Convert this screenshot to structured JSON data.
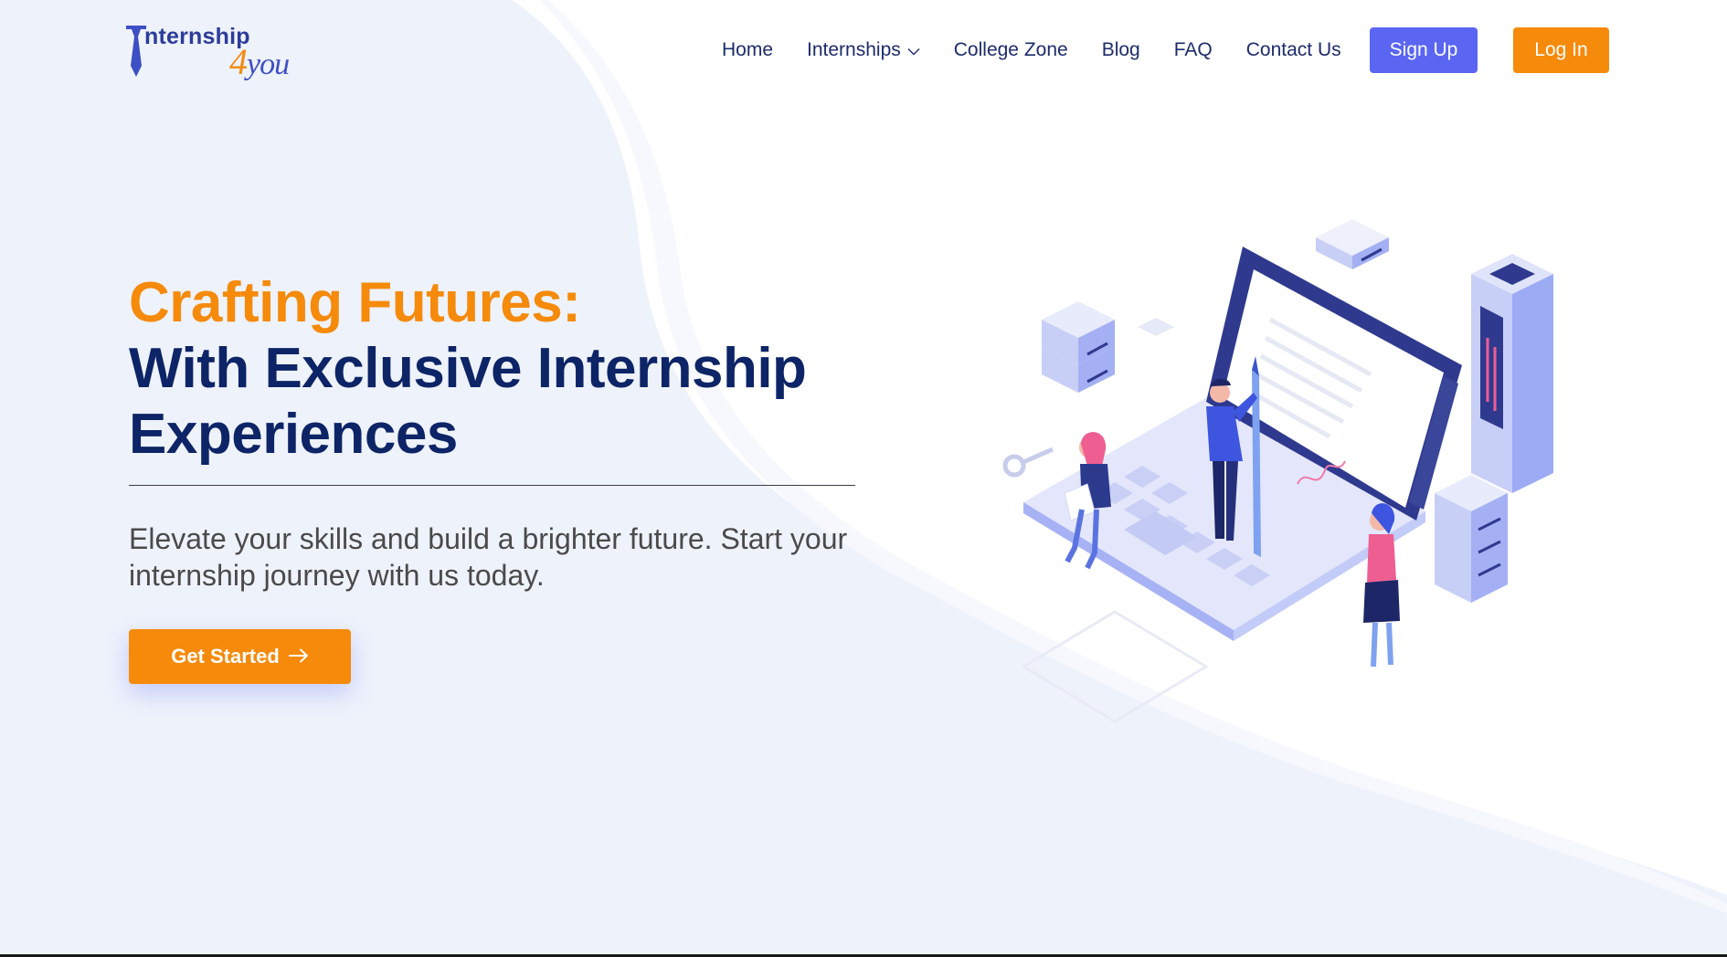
{
  "brand": {
    "logo_text_main": "nternship",
    "logo_text_number": "4",
    "logo_text_you": "you"
  },
  "nav": {
    "items": [
      {
        "label": "Home"
      },
      {
        "label": "Internships",
        "has_dropdown": true
      },
      {
        "label": "College Zone"
      },
      {
        "label": "Blog"
      },
      {
        "label": "FAQ"
      },
      {
        "label": "Contact Us"
      }
    ],
    "signup_label": "Sign Up",
    "login_label": "Log In"
  },
  "hero": {
    "title_line1": "Crafting Futures:",
    "title_line2": "With Exclusive Internship",
    "title_line3": "Experiences",
    "subtitle": "Elevate your skills and build a brighter future. Start your internship journey with us today.",
    "cta_label": "Get Started",
    "cta_icon": "arrow-right-icon"
  },
  "colors": {
    "accent_orange": "#f58a0b",
    "accent_blue": "#5a66f1",
    "heading_navy": "#0d2466",
    "background_wave": "#eef2fb"
  }
}
